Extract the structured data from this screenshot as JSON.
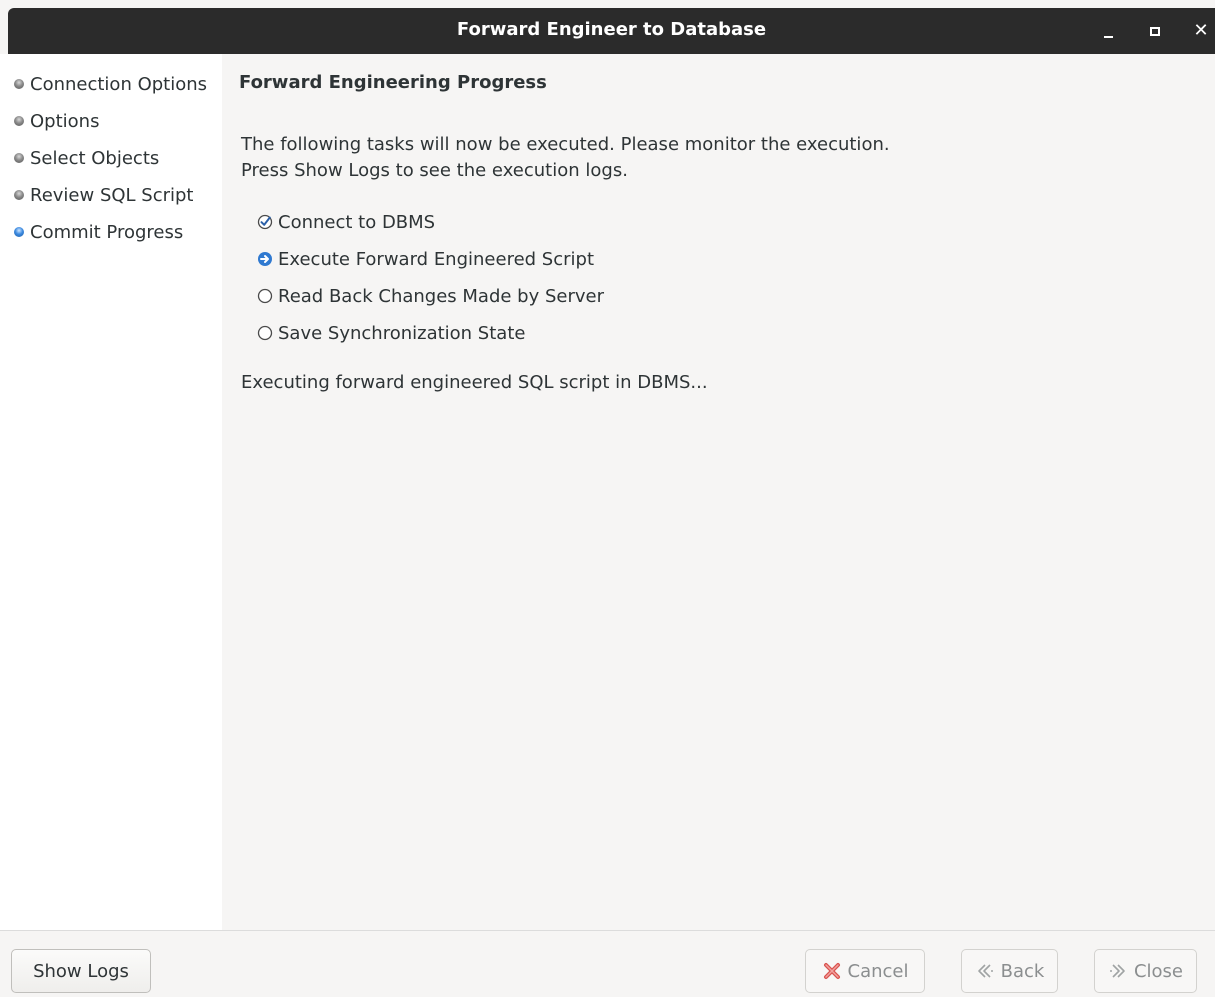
{
  "window": {
    "title": "Forward Engineer to Database"
  },
  "sidebar": {
    "steps": [
      {
        "label": "Connection Options",
        "state": "done"
      },
      {
        "label": "Options",
        "state": "done"
      },
      {
        "label": "Select Objects",
        "state": "done"
      },
      {
        "label": "Review SQL Script",
        "state": "done"
      },
      {
        "label": "Commit Progress",
        "state": "active"
      }
    ]
  },
  "main": {
    "heading": "Forward Engineering Progress",
    "description_line1": "The following tasks will now be executed. Please monitor the execution.",
    "description_line2": "Press Show Logs to see the execution logs.",
    "tasks": [
      {
        "label": "Connect to DBMS",
        "state": "completed",
        "icon": "check-icon"
      },
      {
        "label": "Execute Forward Engineered Script",
        "state": "in-progress",
        "icon": "arrow-right-icon"
      },
      {
        "label": "Read Back Changes Made by Server",
        "state": "pending",
        "icon": "circle-icon"
      },
      {
        "label": "Save Synchronization State",
        "state": "pending",
        "icon": "circle-icon"
      }
    ],
    "status": "Executing forward engineered SQL script in DBMS..."
  },
  "footer": {
    "show_logs_label": "Show Logs",
    "cancel_label": "Cancel",
    "back_label": "Back",
    "close_label": "Close"
  },
  "colors": {
    "titlebar": "#2b2b2b",
    "active_accent": "#3c8ae0",
    "background": "#f6f5f4",
    "sidebar": "#ffffff"
  }
}
